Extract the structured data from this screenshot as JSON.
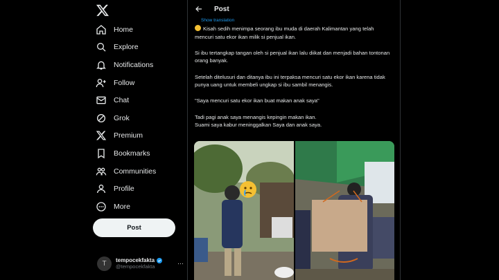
{
  "app": {
    "logo_icon": "x-logo-icon"
  },
  "nav": {
    "items": [
      {
        "label": "Home",
        "icon": "home-icon"
      },
      {
        "label": "Explore",
        "icon": "search-icon"
      },
      {
        "label": "Notifications",
        "icon": "bell-icon"
      },
      {
        "label": "Follow",
        "icon": "person-add-icon"
      },
      {
        "label": "Chat",
        "icon": "mail-icon"
      },
      {
        "label": "Grok",
        "icon": "grok-icon"
      },
      {
        "label": "Premium",
        "icon": "x-premium-icon"
      },
      {
        "label": "Bookmarks",
        "icon": "bookmark-icon"
      },
      {
        "label": "Communities",
        "icon": "communities-icon"
      },
      {
        "label": "Profile",
        "icon": "person-icon"
      },
      {
        "label": "More",
        "icon": "more-circle-icon"
      }
    ],
    "post_button": "Post"
  },
  "account": {
    "name": "tempocekfakta",
    "handle": "@tempocekfakta",
    "avatar_letter": "T",
    "more": "···"
  },
  "header": {
    "title": "Post"
  },
  "tweet": {
    "show_translation": "Show translation",
    "paragraphs": [
      "Kisah sedih menimpa seorang ibu muda di daerah Kalimantan yang telah mencuri satu ekor ikan milik si penjual ikan.",
      "Si ibu tertangkap tangan oleh si penjual ikan lalu diikat dan menjadi bahan tontonan orang banyak.",
      "Setelah ditelusuri dan ditanya ibu ini terpaksa mencuri satu ekor ikan karena tidak punya uang untuk membeli ungkap si ibu sambil menangis.",
      "\"Saya mencuri satu ekor ikan buat makan anak saya\"",
      "Tadi pagi anak saya menangis kepingin makan ikan.\nSuami saya kabur meninggalkan Saya dan anak saya."
    ]
  },
  "colors": {
    "accent": "#1d9bf0",
    "background": "#000000",
    "text": "#e7e9ea",
    "muted": "#71767b",
    "border": "#2f3336"
  }
}
